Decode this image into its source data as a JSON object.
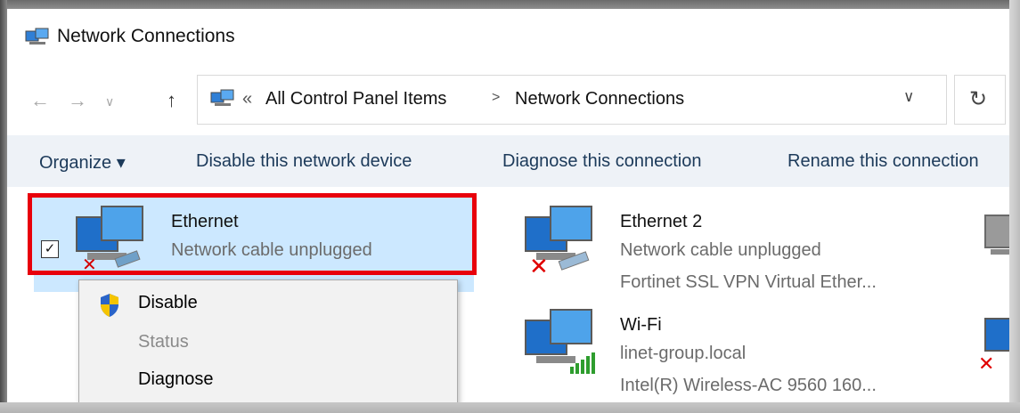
{
  "window": {
    "title": "Network Connections"
  },
  "address_bar": {
    "overflow_marker": "«",
    "crumbs": [
      "All Control Panel Items",
      "Network Connections"
    ],
    "separator": ">"
  },
  "nav": {
    "back": "←",
    "forward": "→",
    "recent": "∨",
    "up": "↑",
    "dropdown": "∨",
    "refresh": "↻"
  },
  "commands": {
    "organize": "Organize ▾",
    "disable": "Disable this network device",
    "diagnose": "Diagnose this connection",
    "rename": "Rename this connection"
  },
  "connections": [
    {
      "name": "Ethernet",
      "status": "Network cable unplugged",
      "adapter": "",
      "selected": true,
      "checked": "✓"
    },
    {
      "name": "Ethernet 2",
      "status": "Network cable unplugged",
      "adapter": "Fortinet SSL VPN Virtual Ether..."
    },
    {
      "name": "Wi-Fi",
      "status": "linet-group.local",
      "adapter": "Intel(R) Wireless-AC 9560 160..."
    }
  ],
  "context_menu": {
    "items": [
      {
        "label": "Disable",
        "enabled": true
      },
      {
        "label": "Status",
        "enabled": false
      },
      {
        "label": "Diagnose",
        "enabled": true
      }
    ]
  },
  "colors": {
    "selection": "#cce8ff",
    "highlight_border": "#e8000b",
    "command_bar": "#eef2f7"
  }
}
